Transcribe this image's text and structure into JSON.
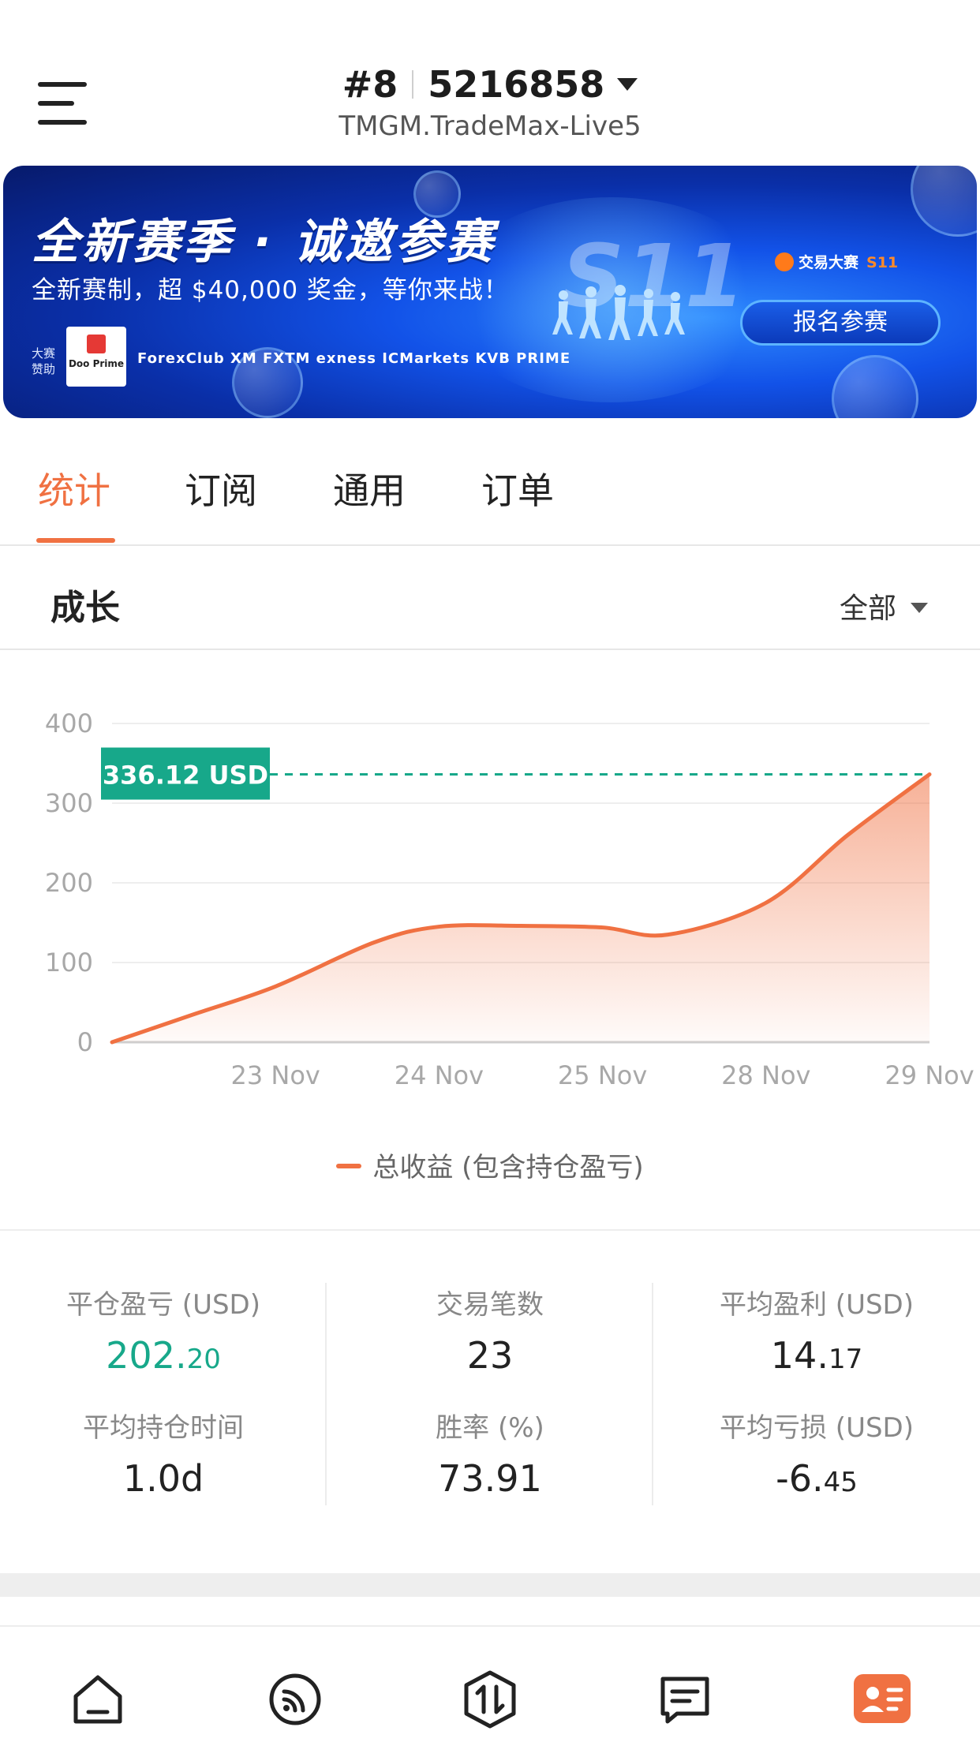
{
  "header": {
    "rank": "#8",
    "account_id": "5216858",
    "server": "TMGM.TradeMax-Live5"
  },
  "banner": {
    "title": "全新赛季 · 诚邀参赛",
    "subtitle": "全新赛制，超 $40,000 奖金，等你来战！",
    "season_mark": "S11",
    "sponsor_label": "大赛赞助",
    "main_sponsor": "Doo Prime",
    "sponsors": "ForexClub  XM  FXTM  exness  ICMarkets  KVB PRIME",
    "brand": "交易大赛",
    "brand_season": "S11",
    "cta_label": "报名参赛"
  },
  "tabs": [
    {
      "label": "统计",
      "active": true
    },
    {
      "label": "订阅",
      "active": false
    },
    {
      "label": "通用",
      "active": false
    },
    {
      "label": "订单",
      "active": false
    }
  ],
  "growth": {
    "title": "成长",
    "range_label": "全部"
  },
  "chart_data": {
    "type": "area",
    "y_ticks": [
      0,
      100,
      200,
      300,
      400
    ],
    "ylim": [
      0,
      400
    ],
    "x_tick_labels": [
      "23 Nov",
      "24 Nov",
      "25 Nov",
      "28 Nov",
      "29 Nov"
    ],
    "series": [
      {
        "name": "总收益 (包含持仓盈亏)",
        "color": "#f07142",
        "points": [
          [
            0,
            0
          ],
          [
            0.5,
            35
          ],
          [
            1,
            70
          ],
          [
            1.6,
            125
          ],
          [
            2,
            145
          ],
          [
            2.5,
            146
          ],
          [
            3,
            144
          ],
          [
            3.4,
            135
          ],
          [
            4,
            175
          ],
          [
            4.5,
            260
          ],
          [
            5,
            336.12
          ]
        ]
      }
    ],
    "current_value_label": "336.12 USD",
    "current_value": 336.12,
    "marker_color": "#17a88a",
    "grid": true,
    "legend_position": "bottom-center"
  },
  "stats": [
    {
      "label": "平仓盈亏 (USD)",
      "int": "202.",
      "dec": "20",
      "color": "green"
    },
    {
      "label": "交易笔数",
      "int": "23",
      "dec": "",
      "color": "default"
    },
    {
      "label": "平均盈利 (USD)",
      "int": "14.",
      "dec": "17",
      "color": "default"
    },
    {
      "label": "平均持仓时间",
      "int": "1.0d",
      "dec": "",
      "color": "default"
    },
    {
      "label": "胜率 (%)",
      "int": "73.91",
      "dec": "",
      "color": "default"
    },
    {
      "label": "平均亏损 (USD)",
      "int": "-6.",
      "dec": "45",
      "color": "default"
    }
  ],
  "bottom_nav": [
    {
      "icon": "home-icon",
      "active": false
    },
    {
      "icon": "signal-feed-icon",
      "active": false
    },
    {
      "icon": "trade-icon",
      "active": false
    },
    {
      "icon": "messages-icon",
      "active": false
    },
    {
      "icon": "profile-card-icon",
      "active": true,
      "color": "#f07142"
    }
  ]
}
